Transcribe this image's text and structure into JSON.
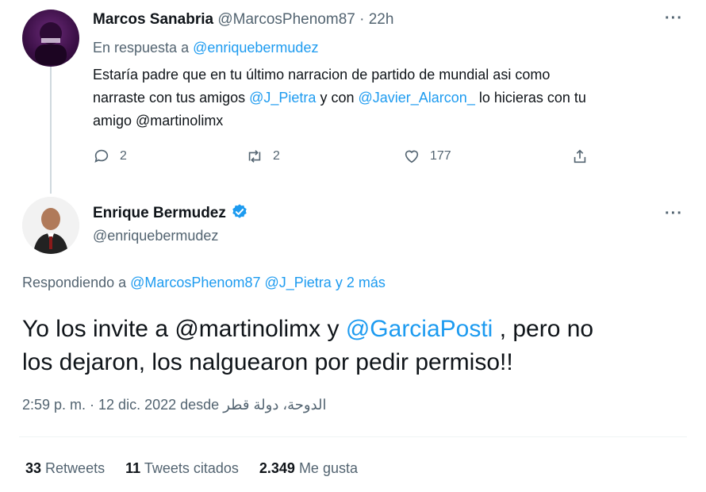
{
  "reply_tweet": {
    "display_name": "Marcos Sanabria",
    "handle": "@MarcosPhenom87",
    "separator": "·",
    "time": "22h",
    "replying_prefix": "En respuesta a",
    "replying_to": "@enriquebermudez",
    "text_1": "Estaría padre que en tu último narracion de partido de mundial asi como",
    "text_2a": "narraste con tus amigos",
    "mention_1": "@J_Pietra",
    "text_2b": "y con",
    "mention_2": "@Javier_Alarcon_",
    "text_2c": "lo hicieras con tu",
    "text_3": "amigo @martinolimx",
    "replies": "2",
    "retweets": "2",
    "likes": "177",
    "more": "···"
  },
  "main_tweet": {
    "display_name": "Enrique Bermudez",
    "handle": "@enriquebermudez",
    "more": "···",
    "replying_prefix": "Respondiendo a",
    "replying_to_1": "@MarcosPhenom87",
    "replying_to_2": "@J_Pietra",
    "replying_to_more": "y 2 más",
    "text_a": "Yo los invite a @martinolimx y",
    "text_mention": "@GarciaPosti",
    "text_b": ", pero no",
    "text_line2": "los dejaron, los nalguearon por pedir permiso!!",
    "timestamp": "2:59 p. m. · 12 dic. 2022 desde",
    "location": "الدوحة، دولة قطر",
    "stats": {
      "retweets_count": "33",
      "retweets_label": "Retweets",
      "quotes_count": "11",
      "quotes_label": "Tweets citados",
      "likes_count": "2.349",
      "likes_label": "Me gusta"
    }
  },
  "colors": {
    "link": "#1d9bf0",
    "muted": "#536471",
    "verified": "#1d9bf0"
  }
}
